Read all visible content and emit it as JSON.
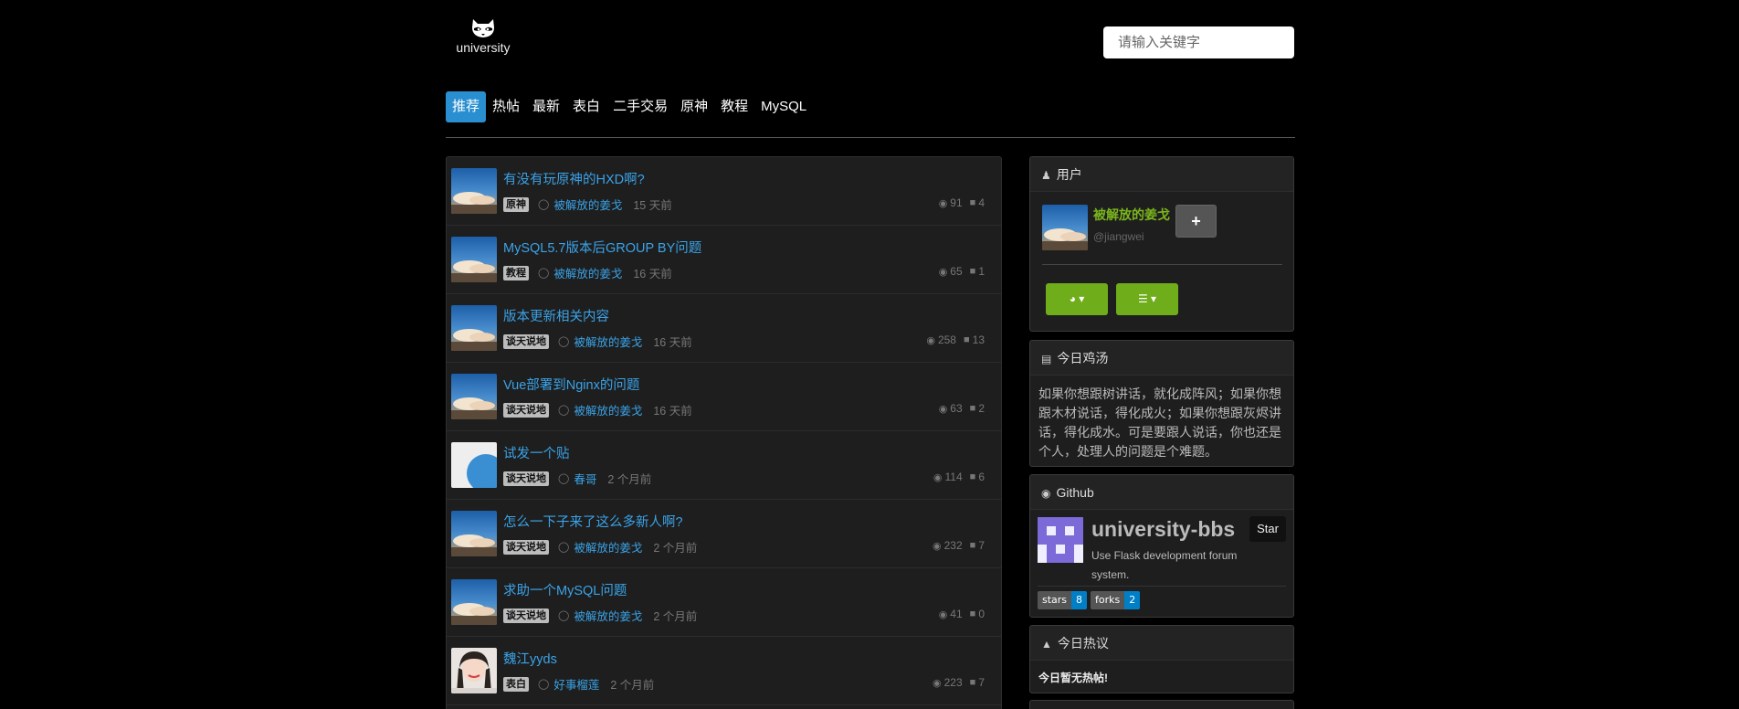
{
  "site": {
    "logo_text": "university"
  },
  "search": {
    "placeholder": "请输入关键字"
  },
  "nav": [
    "推荐",
    "热帖",
    "最新",
    "表白",
    "二手交易",
    "原神",
    "教程",
    "MySQL"
  ],
  "posts": [
    {
      "title": "有没有玩原神的HXD啊?",
      "tag": "原神",
      "author": "被解放的姜戈",
      "time": "15 天前",
      "views": "91",
      "comments": "4",
      "avatar": "landscape"
    },
    {
      "title": "MySQL5.7版本后GROUP BY问题",
      "tag": "教程",
      "author": "被解放的姜戈",
      "time": "16 天前",
      "views": "65",
      "comments": "1",
      "avatar": "landscape"
    },
    {
      "title": "版本更新相关内容",
      "tag": "谈天说地",
      "author": "被解放的姜戈",
      "time": "16 天前",
      "views": "258",
      "comments": "13",
      "avatar": "landscape"
    },
    {
      "title": "Vue部署到Nginx的问题",
      "tag": "谈天说地",
      "author": "被解放的姜戈",
      "time": "16 天前",
      "views": "63",
      "comments": "2",
      "avatar": "landscape"
    },
    {
      "title": "试发一个贴",
      "tag": "谈天说地",
      "author": "春哥",
      "time": "2 个月前",
      "views": "114",
      "comments": "6",
      "avatar": "circle"
    },
    {
      "title": "怎么一下子来了这么多新人啊?",
      "tag": "谈天说地",
      "author": "被解放的姜戈",
      "time": "2 个月前",
      "views": "232",
      "comments": "7",
      "avatar": "landscape"
    },
    {
      "title": "求助一个MySQL问题",
      "tag": "谈天说地",
      "author": "被解放的姜戈",
      "time": "2 个月前",
      "views": "41",
      "comments": "0",
      "avatar": "landscape"
    },
    {
      "title": "魏江yyds",
      "tag": "表白",
      "author": "好事榴莲",
      "time": "2 个月前",
      "views": "223",
      "comments": "7",
      "avatar": "person"
    }
  ],
  "user_panel": {
    "heading": "用户",
    "name": "被解放的姜戈",
    "handle": "@jiangwei",
    "follow_label": "+"
  },
  "soup_panel": {
    "heading": "今日鸡汤",
    "quote": "如果你想跟树讲话，就化成阵风；如果你想跟木材说话，得化成火；如果你想跟灰烬讲话，得化成水。可是要跟人说话，你也还是个人，处理人的问题是个难题。"
  },
  "github_panel": {
    "heading": "Github",
    "repo": "university-bbs",
    "description": "Use Flask development forum system.",
    "star_label": "Star",
    "stars_label": "stars",
    "stars": "8",
    "forks_label": "forks",
    "forks": "2"
  },
  "hot_panel": {
    "heading": "今日热议",
    "empty_text": "今日暂无热帖!"
  },
  "colors": {
    "accent_blue": "#2a8fd0",
    "link_blue": "#3aa3e8",
    "green": "#6fad1a",
    "username_green": "#7ab51d"
  }
}
